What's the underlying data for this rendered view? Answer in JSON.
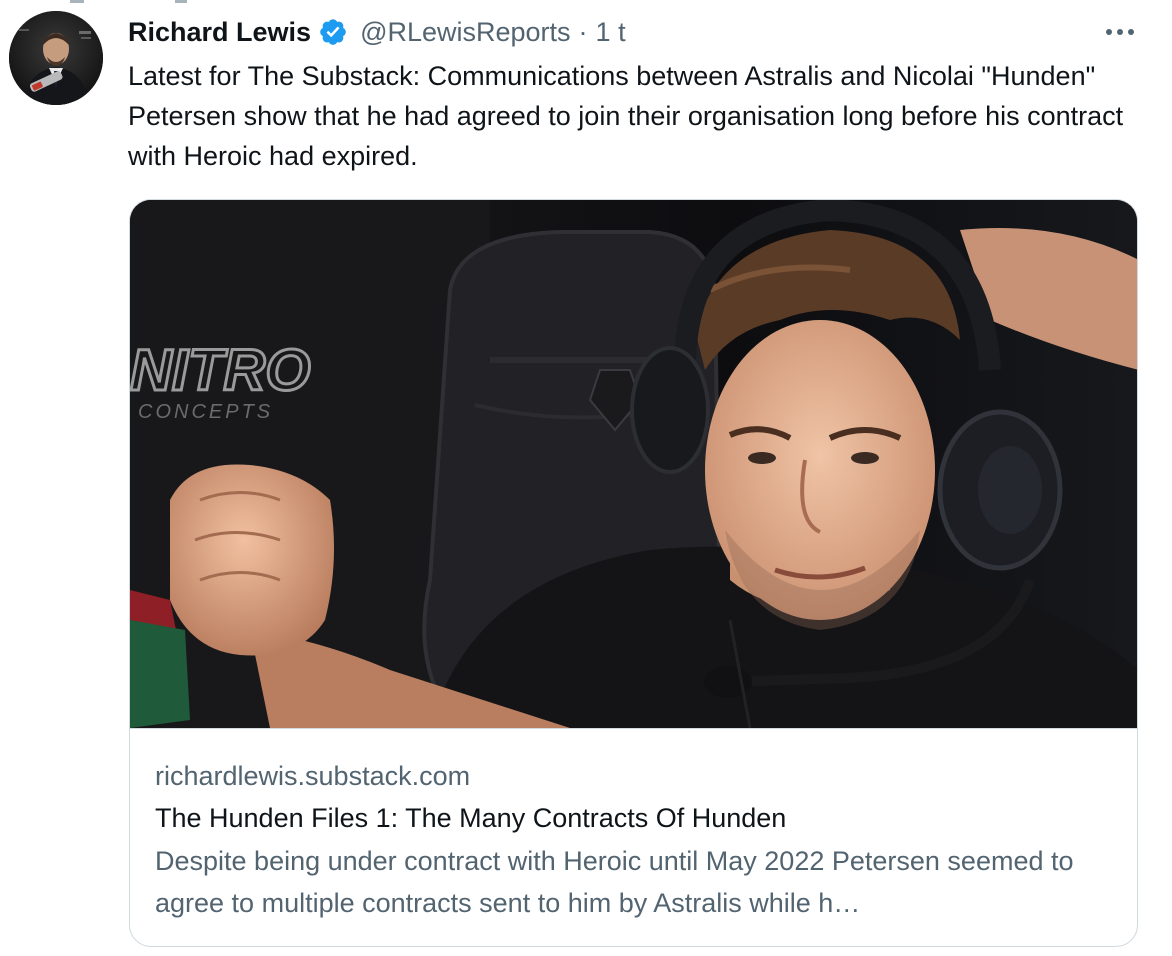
{
  "tweet": {
    "author_name": "Richard Lewis",
    "handle": "@RLewisReports",
    "separator": "·",
    "time": "1 t",
    "text": "Latest for The Substack: Communications between Astralis and Nicolai \"Hunden\" Petersen show that he had agreed to join their organisation long before his contract with Heroic had expired.",
    "verified_color": "#1d9bf0"
  },
  "card": {
    "domain": "richardlewis.substack.com",
    "title": "The Hunden Files 1: The Many Contracts Of Hunden",
    "description": "Despite being under contract with Heroic until May 2022 Petersen seemed to agree to multiple contracts sent to him by Astralis while h…",
    "image_sponsor_text": "NITRO",
    "image_sponsor_subtext": "CONCEPTS"
  },
  "icons": {
    "avatar": "avatar-photo",
    "verified": "verified-badge-icon",
    "more": "more-options-icon"
  }
}
